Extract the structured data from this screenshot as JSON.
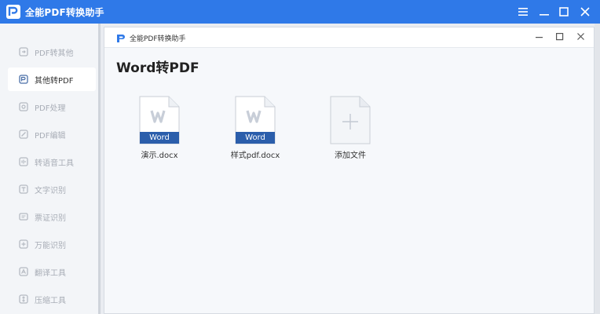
{
  "app": {
    "title": "全能PDF转换助手"
  },
  "window_controls": [
    "menu-icon",
    "minimize-icon",
    "maximize-icon",
    "close-icon"
  ],
  "sidebar": {
    "items": [
      {
        "label": "PDF转其他",
        "icon": "pdf-convert-icon",
        "active": false
      },
      {
        "label": "其他转PDF",
        "icon": "to-pdf-icon",
        "active": true
      },
      {
        "label": "PDF处理",
        "icon": "pdf-process-icon",
        "active": false
      },
      {
        "label": "PDF编辑",
        "icon": "pdf-edit-icon",
        "active": false
      },
      {
        "label": "转语音工具",
        "icon": "speech-icon",
        "active": false
      },
      {
        "label": "文字识别",
        "icon": "ocr-icon",
        "active": false
      },
      {
        "label": "票证识别",
        "icon": "ticket-icon",
        "active": false
      },
      {
        "label": "万能识别",
        "icon": "universal-icon",
        "active": false
      },
      {
        "label": "翻译工具",
        "icon": "translate-icon",
        "active": false
      },
      {
        "label": "压缩工具",
        "icon": "compress-icon",
        "active": false
      }
    ]
  },
  "dialog": {
    "title": "全能PDF转换助手",
    "heading": "Word转PDF",
    "files": [
      {
        "name": "演示.docx",
        "badge": "Word"
      },
      {
        "name": "样式pdf.docx",
        "badge": "Word"
      }
    ],
    "add_label": "添加文件"
  },
  "colors": {
    "accent": "#2f79e8",
    "word_badge": "#2b5eab",
    "word_letter": "#c8ced8"
  }
}
